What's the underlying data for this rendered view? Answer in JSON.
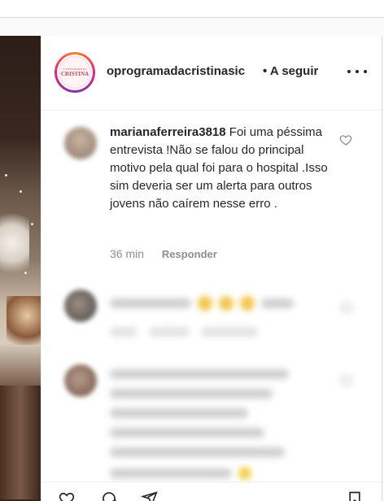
{
  "post": {
    "username": "oprogramadacristinasic",
    "separator": "•",
    "follow_label": "A seguir",
    "avatar_logo_small": "O PROGRAMA DA",
    "avatar_logo_big": "CRISTINA"
  },
  "comments": [
    {
      "user": "marianaferreira3818",
      "text": "Foi uma péssima entrevista !Não se falou do principal motivo pela qual foi para o hospital .Isso sim deveria ser um alerta para outros jovens não caírem nesse erro .",
      "time": "36 min",
      "reply_label": "Responder"
    }
  ],
  "colors": {
    "text": "#262626",
    "secondary": "#8e8e8e",
    "border": "#dbdbdb"
  },
  "icons": [
    "more-icon",
    "heart-icon",
    "comment-icon",
    "share-icon",
    "bookmark-icon"
  ]
}
